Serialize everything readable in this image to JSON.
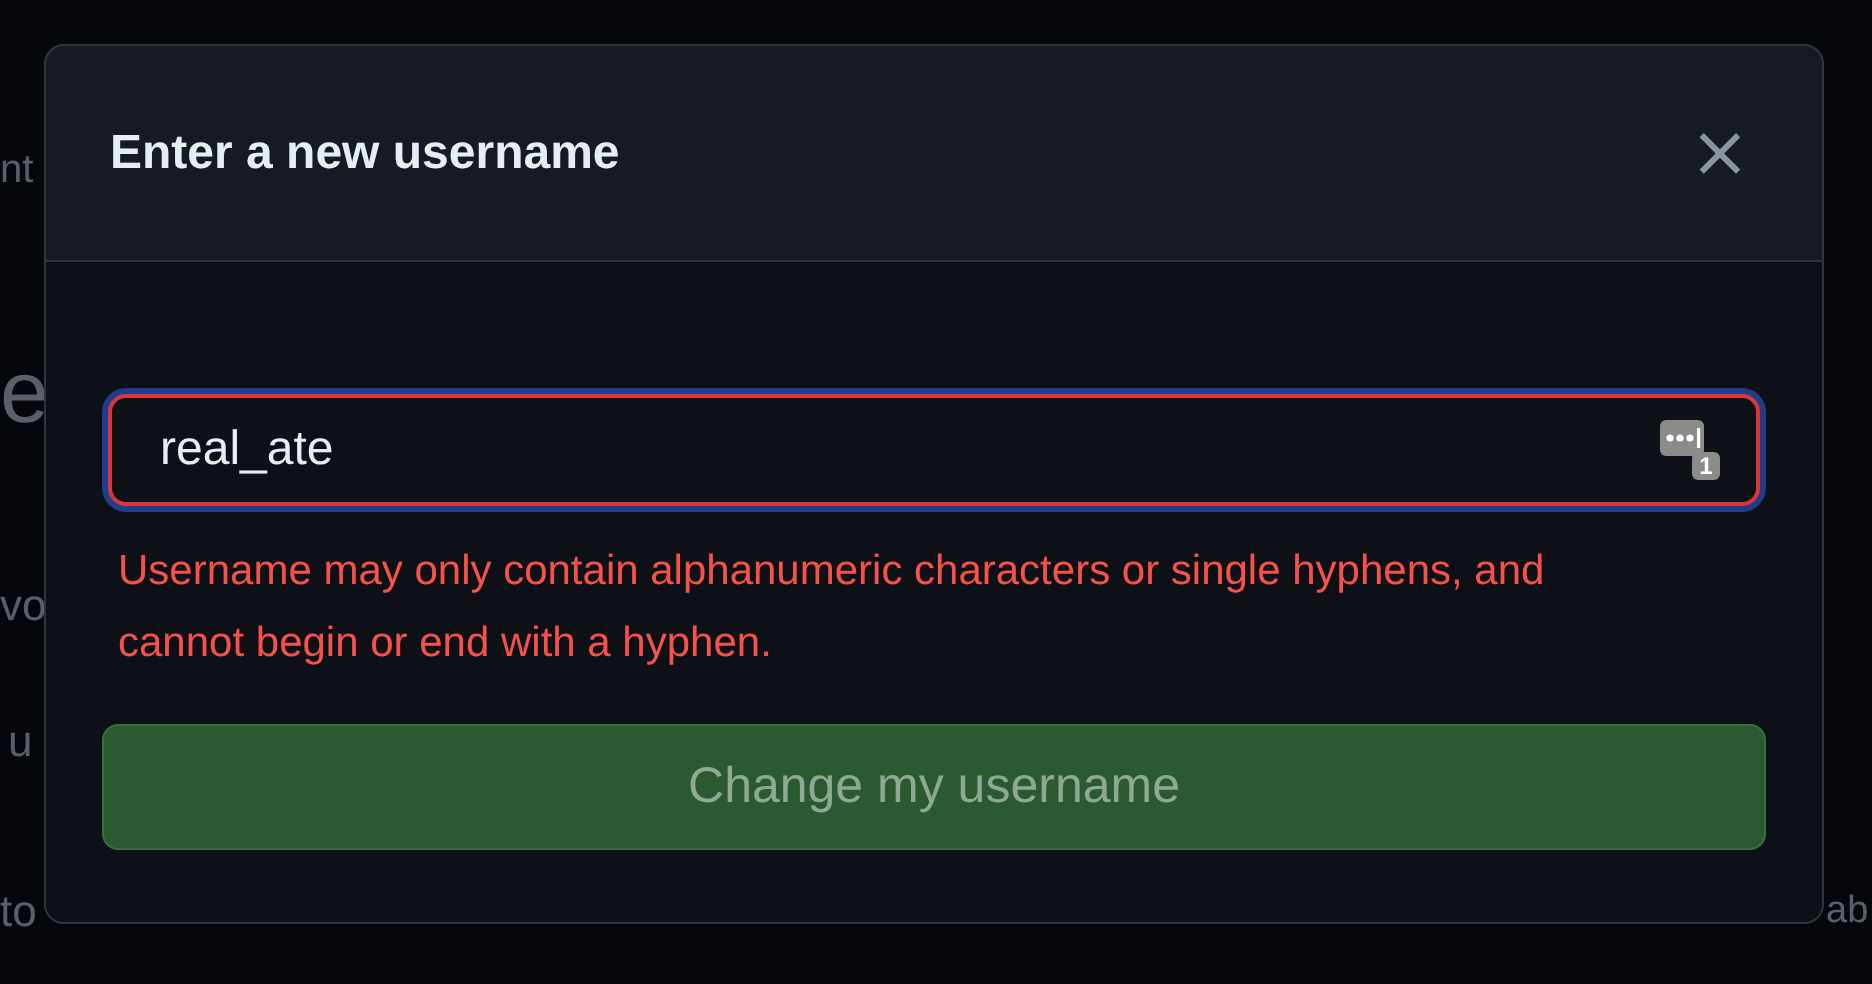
{
  "background_fragments": [
    "nt",
    "e",
    "vo",
    "u",
    "to",
    "ab"
  ],
  "dialog": {
    "title": "Enter a new username",
    "close_icon": "×",
    "field": {
      "value": "real_ate",
      "invalid": true,
      "focused": true,
      "autofill_badge": "1"
    },
    "error": "Username may only contain alphanumeric characters or single hyphens, and cannot begin or end with a hyphen.",
    "submit": {
      "label": "Change my username",
      "disabled": true
    }
  }
}
